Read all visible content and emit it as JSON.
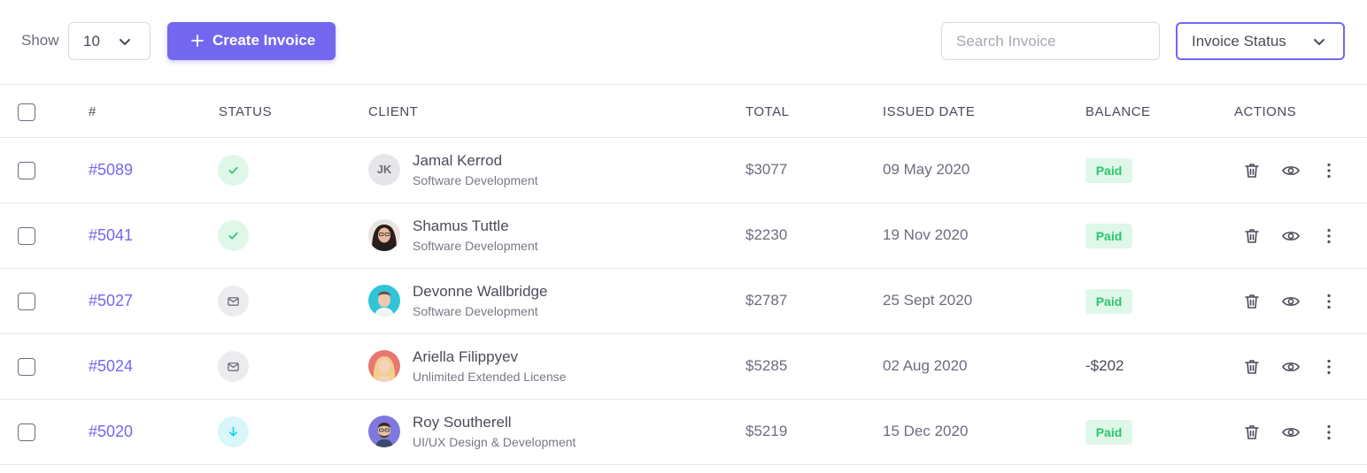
{
  "toolbar": {
    "show_label": "Show",
    "page_size": "10",
    "create_label": "Create Invoice",
    "search_placeholder": "Search Invoice",
    "status_filter": "Invoice Status"
  },
  "columns": [
    "#",
    "STATUS",
    "CLIENT",
    "TOTAL",
    "ISSUED DATE",
    "BALANCE",
    "ACTIONS"
  ],
  "rows": [
    {
      "id": "#5089",
      "status_icon": "check-icon",
      "status_color": "#28c76f",
      "client": "Jamal Kerrod",
      "subtitle": "Software Development",
      "avatar": "JK",
      "total": "$3077",
      "date": "09 May 2020",
      "balance": "Paid"
    },
    {
      "id": "#5041",
      "status_icon": "check-icon",
      "status_color": "#28c76f",
      "client": "Shamus Tuttle",
      "subtitle": "Software Development",
      "avatar": "photo",
      "total": "$2230",
      "date": "19 Nov 2020",
      "balance": "Paid"
    },
    {
      "id": "#5027",
      "status_icon": "mail-icon",
      "status_color": "#6f6b7d",
      "client": "Devonne Wallbridge",
      "subtitle": "Software Development",
      "avatar": "photo",
      "total": "$2787",
      "date": "25 Sept 2020",
      "balance": "Paid"
    },
    {
      "id": "#5024",
      "status_icon": "mail-icon",
      "status_color": "#6f6b7d",
      "client": "Ariella Filippyev",
      "subtitle": "Unlimited Extended License",
      "avatar": "photo",
      "total": "$5285",
      "date": "02 Aug 2020",
      "balance": "-$202"
    },
    {
      "id": "#5020",
      "status_icon": "arrow-down-icon",
      "status_color": "#00cfe8",
      "client": "Roy Southerell",
      "subtitle": "UI/UX Design & Development",
      "avatar": "photo",
      "total": "$5219",
      "date": "15 Dec 2020",
      "balance": "Paid"
    }
  ],
  "colors": {
    "accent": "#7367f0",
    "success": "#28c76f",
    "info": "#00cfe8"
  }
}
